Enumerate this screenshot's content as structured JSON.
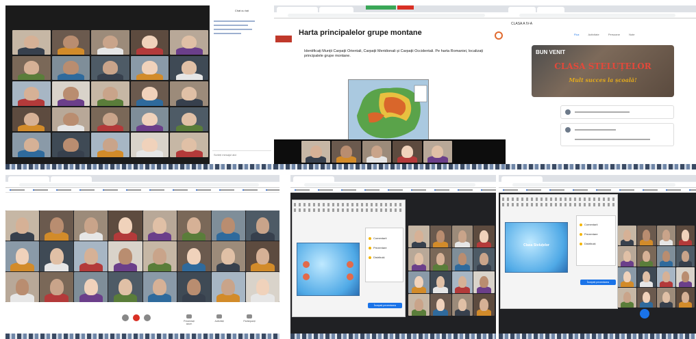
{
  "colors": {
    "zoom_bg": "#1b1b1b",
    "accent_blue": "#1a73e8",
    "brand_orange": "#e06a2e",
    "banner_red": "#e4483a",
    "banner_gold": "#e1a91e"
  },
  "panel1": {
    "chat_title": "Chat cu toți",
    "chat_input_placeholder": "Scrieți mesajul aici"
  },
  "panel2": {
    "slide_title": "Harta principalelor grupe montane",
    "slide_text": "Identificați Munții Carpații Orientali, Carpații Meridionali și Carpații Occidentali. Pe harta Romaniei, localizați principalele grupe montane."
  },
  "panel3": {
    "class_name": "CLASA A IV-A",
    "tabs": [
      "Flux",
      "Activitate",
      "Persoane",
      "Note"
    ],
    "banner_line1": "BUN VENIT",
    "banner_line2": "CLASA STELUȚELOR",
    "banner_line3": "Mult succes la școală!"
  },
  "panel4": {
    "bottom_buttons": [
      "Prezentați acum",
      "Activități",
      "Participanți"
    ]
  },
  "panel5": {
    "menu_items": [
      "Comentarii",
      "Prezentare",
      "Distribuiți"
    ],
    "button_label": "Începeți prezentarea"
  },
  "panel6": {
    "slide_text": "Clasa Steluțelor",
    "menu_items": [
      "Comentarii",
      "Prezentare",
      "Distribuiți"
    ],
    "button_label": "Începeți prezentarea"
  }
}
